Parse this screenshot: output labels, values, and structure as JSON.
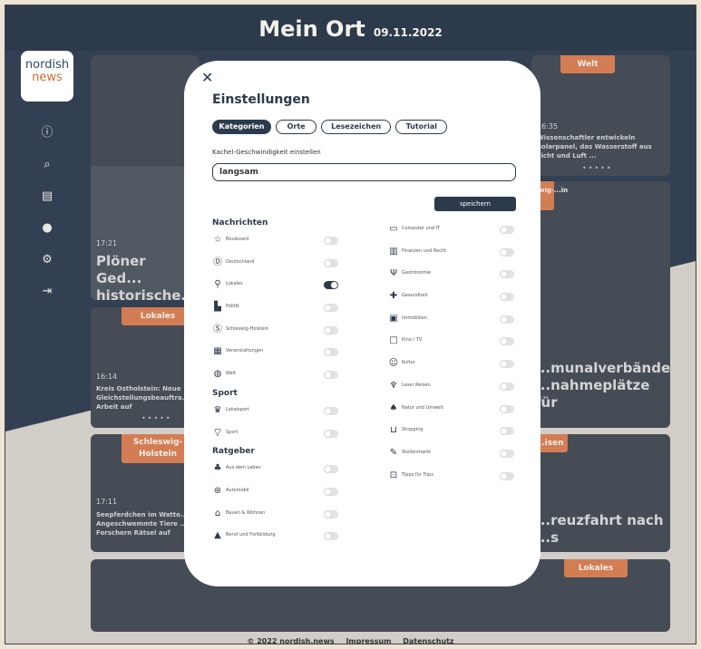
{
  "header": {
    "title": "Mein Ort",
    "date": "09.11.2022"
  },
  "logo": {
    "line1": "nordish",
    "line2": "news"
  },
  "sidebar": {
    "items": [
      {
        "icon": "info-icon"
      },
      {
        "icon": "search-icon"
      },
      {
        "icon": "archive-icon"
      },
      {
        "icon": "user-icon"
      },
      {
        "icon": "gear-icon"
      },
      {
        "icon": "logout-icon"
      }
    ]
  },
  "tiles": {
    "t1": {
      "time": "17:21",
      "headline": "Plöner Ged... historische..."
    },
    "t2": {
      "tag": "Welt",
      "time": "16:35",
      "snippet": "Wissenschaftler entwickeln Solarpanel, das Wasserstoff aus Licht und Luft ..."
    },
    "t3": {
      "tag": "Lokales",
      "time": "16:14",
      "snippet": "Kreis Ostholstein: Neue Gleichstellungsbeauftra... Arbeit auf"
    },
    "t4": {
      "tag": "...wig-...in",
      "headline": "...munalverbände ...nahmeplätze für"
    },
    "t5": {
      "tag": "Schleswig-Holstein",
      "time": "17:11",
      "snippet": "Seepferdchen im Watte... Angeschwemmte Tiere ... Forschern Rätsel auf"
    },
    "t6": {
      "tag": "...isen",
      "headline": "...reuzfahrt nach ...s"
    },
    "t7": {
      "tag": "Lokales"
    }
  },
  "footer": {
    "copyright": "© 2022 nordish.news",
    "impressum": "Impressum",
    "datenschutz": "Datenschutz"
  },
  "modal": {
    "title": "Einstellungen",
    "tabs": [
      "Kategorien",
      "Orte",
      "Lesezeichen",
      "Tutorial"
    ],
    "speed_label": "Kachel-Geschwindigkeit einstellen",
    "speed_value": "langsam",
    "save_label": "speichern",
    "sections": {
      "nachrichten": "Nachrichten",
      "sport": "Sport",
      "ratgeber": "Ratgeber"
    },
    "nachrichten_items": [
      {
        "label": "Boulevard",
        "icon": "star-icon",
        "on": false
      },
      {
        "label": "Deutschland",
        "icon": "d-circle-icon",
        "on": false
      },
      {
        "label": "Lokales",
        "icon": "pin-icon",
        "on": true
      },
      {
        "label": "Politik",
        "icon": "podium-icon",
        "on": false
      },
      {
        "label": "Schleswig-Holstein",
        "icon": "sh-circle-icon",
        "on": false
      },
      {
        "label": "Veranstaltungen",
        "icon": "calendar-icon",
        "on": false
      },
      {
        "label": "Welt",
        "icon": "globe-icon",
        "on": false
      }
    ],
    "sport_items": [
      {
        "label": "Lokalsport",
        "icon": "trophy-icon",
        "on": false
      },
      {
        "label": "Sport",
        "icon": "cup-icon",
        "on": false
      }
    ],
    "ratgeber_items": [
      {
        "label": "Aus dem Leben",
        "icon": "people-icon",
        "on": false
      },
      {
        "label": "Automobil",
        "icon": "wheel-icon",
        "on": false
      },
      {
        "label": "Bauen & Wohnen",
        "icon": "house-icon",
        "on": false
      },
      {
        "label": "Beruf und Fortbildung",
        "icon": "hat-icon",
        "on": false
      }
    ],
    "right_items": [
      {
        "label": "Computer und IT",
        "icon": "monitor-icon",
        "on": false
      },
      {
        "label": "Finanzen und Recht",
        "icon": "bar-chart-icon",
        "on": false
      },
      {
        "label": "Gastronomie",
        "icon": "cutlery-icon",
        "on": false
      },
      {
        "label": "Gesundheit",
        "icon": "plus-icon",
        "on": false
      },
      {
        "label": "Immobilien",
        "icon": "building-icon",
        "on": false
      },
      {
        "label": "Kino / TV",
        "icon": "tv-icon",
        "on": false
      },
      {
        "label": "Kultur",
        "icon": "masks-icon",
        "on": false
      },
      {
        "label": "Leser Reisen",
        "icon": "palm-icon",
        "on": false
      },
      {
        "label": "Natur und Umwelt",
        "icon": "leaf-icon",
        "on": false
      },
      {
        "label": "Shopping",
        "icon": "cart-icon",
        "on": false
      },
      {
        "label": "Stellenmarkt",
        "icon": "pen-icon",
        "on": false
      },
      {
        "label": "Tipps für Trips",
        "icon": "suitcase-icon",
        "on": false
      }
    ]
  }
}
